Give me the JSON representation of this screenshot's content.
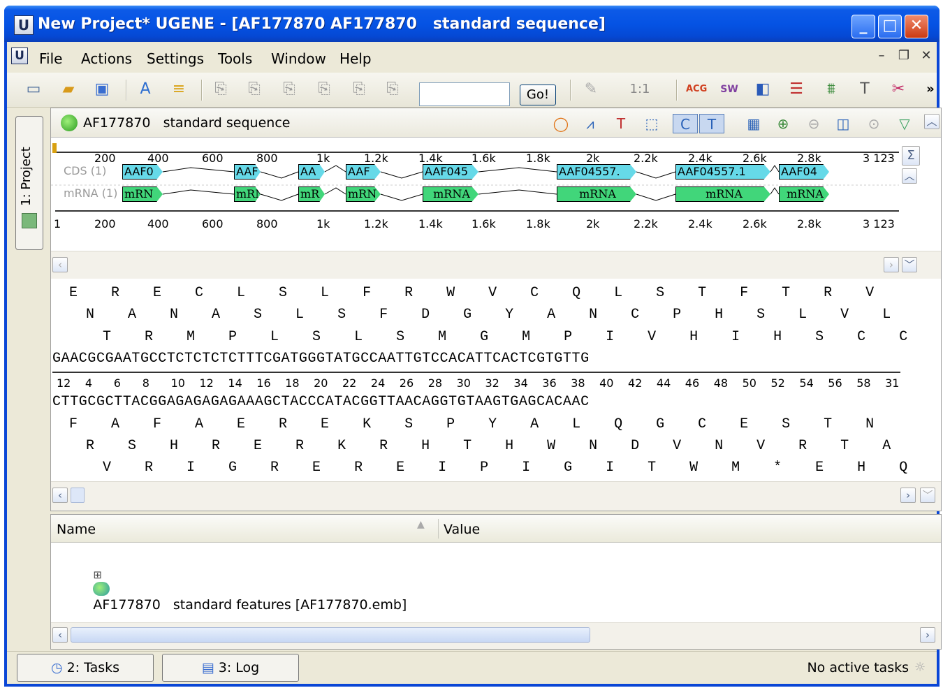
{
  "window": {
    "title": "New Project* UGENE - [AF177870 AF177870   standard sequence]",
    "app_icon": "U",
    "minimize": "_",
    "maximize": "□",
    "close": "✕"
  },
  "menu": {
    "items": [
      "File",
      "Actions",
      "Settings",
      "Tools",
      "Window",
      "Help"
    ],
    "mdi_minimize": "–",
    "mdi_restore": "❐",
    "mdi_close": "✕"
  },
  "toolbar": {
    "search_value": "",
    "go_label": "Go!",
    "zoom_label": "1:1",
    "more": "»"
  },
  "sidebar": {
    "project_tab": "1: Project"
  },
  "sequence_view": {
    "title": "AF177870   standard sequence",
    "sum_button": "Σ",
    "ruler_labels": [
      "1",
      "200",
      "400",
      "600",
      "800",
      "1k",
      "1.2k",
      "1.4k",
      "1.6k",
      "1.8k",
      "2k",
      "2.2k",
      "2.4k",
      "2.6k",
      "2.8k",
      "3 123"
    ],
    "track_cds_label": "CDS (1)",
    "track_mrna_label": "mRNA (1)",
    "cds_features": [
      "AAF0",
      "AAF",
      "AA",
      "AAF",
      "AAF045",
      "AAF04557.",
      "AAF04557.1",
      "AAF04"
    ],
    "mrna_features": [
      "mRN",
      "mRN",
      "mR",
      "mRN",
      "mRNA",
      "mRNA",
      "mRNA",
      "mRNA"
    ],
    "frames_top": [
      "E    R    E    C    L    S    L    F    R    W    V    C    Q    L    S    T    F    T    R    V",
      "  N    A    N    A    S    L    S    F    D    G    Y    A    N    C    P    H    S    L    V    L",
      "    T    R    M    P    L    S    L    S    M    G    M    P    I    V    H    I    H    S    C    C"
    ],
    "forward_strand": "GAACGCGAATGCCTCTCTCTCTTTCGATGGGTATGCCAATTGTCCACATTCACTCGTGTTG",
    "detail_ruler": [
      "12",
      "4",
      "6",
      "8",
      "10",
      "12",
      "14",
      "16",
      "18",
      "20",
      "22",
      "24",
      "26",
      "28",
      "30",
      "32",
      "34",
      "36",
      "38",
      "40",
      "42",
      "44",
      "46",
      "48",
      "50",
      "52",
      "54",
      "56",
      "58",
      "31"
    ],
    "reverse_strand": "CTTGCGCTTACGGAGAGAGAGAAAGCTACCCATACGGTTAACAGGTGTAAGTGAGCACAAC",
    "frames_bottom": [
      "F    A    F    A    E    R    E    K    S    P    Y    A    L    Q    G    C    E    S    T    N",
      "  R    S    H    R    E    R    K    R    H    T    H    W    N    D    V    N    V    R    T    A",
      "    V    R    I    G    R    E    R    E    I    P    I    G    I    T    W    M    *    E    H    Q"
    ]
  },
  "properties": {
    "col_name": "Name",
    "col_value": "Value",
    "sort_indicator": "▲",
    "tree_item": "AF177870   standard features [AF177870.emb]",
    "expander": "⊞"
  },
  "bottom": {
    "tab_tasks": "2: Tasks",
    "tab_log": "3: Log",
    "status": "No active tasks"
  },
  "colors": {
    "title_bar": "#0553e4",
    "cds_feature": "#66d9e8",
    "mrna_feature": "#41d67a",
    "start_codon": "#1a9a2a",
    "stop_codon": "#b01010"
  }
}
